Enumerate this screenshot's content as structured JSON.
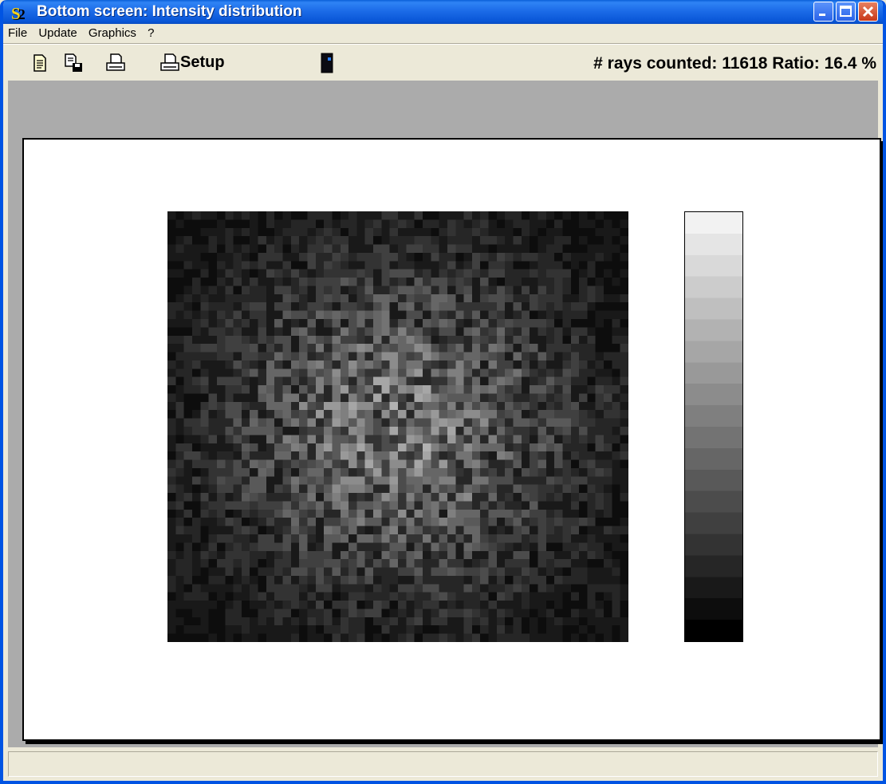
{
  "window": {
    "title": "Bottom screen: Intensity distribution",
    "app_icon": {
      "glyph_s": "S",
      "glyph_2": "2"
    }
  },
  "title_buttons": [
    "minimize-icon",
    "maximize-icon",
    "close-icon"
  ],
  "menu": [
    "File",
    "Update",
    "Graphics",
    "?"
  ],
  "toolbar": {
    "icons": [
      "new-document-icon",
      "save-document-icon",
      "printer-icon",
      "printer-setup-icon",
      "exit-door-icon"
    ],
    "setup_label": "Setup",
    "status": "# rays counted: 11618 Ratio: 16.4 %"
  },
  "chart_data": {
    "type": "heatmap",
    "grid": {
      "cols": 56,
      "rows": 52
    },
    "distribution": "radial, brightest at center, dark at edges, noisy",
    "colorbar": {
      "levels": 20,
      "from": "#000000",
      "to": "#f2f2f2"
    }
  }
}
